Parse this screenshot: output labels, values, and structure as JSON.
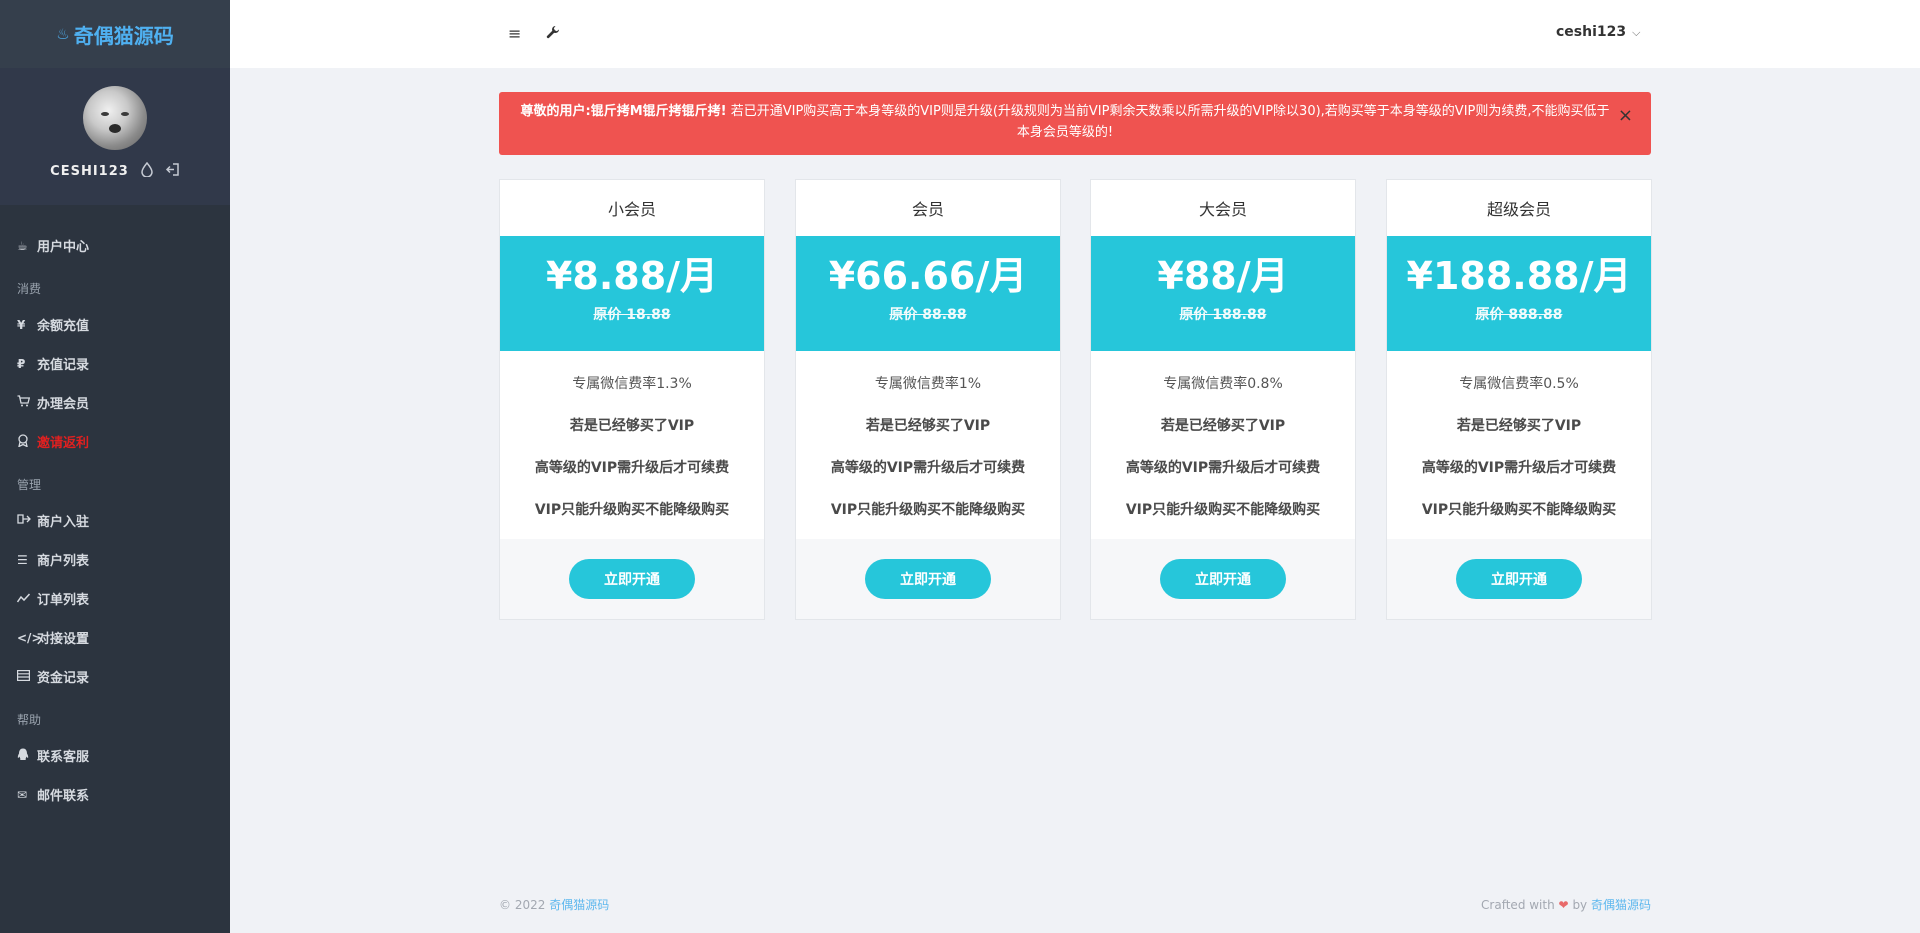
{
  "brand": {
    "icon": "flame-icon",
    "name": "奇偶猫源码"
  },
  "profile": {
    "username": "CESHI123",
    "icons": [
      "droplet-icon",
      "logout-icon"
    ]
  },
  "nav": {
    "top": [
      {
        "label": "用户中心",
        "icon": "cup-icon"
      }
    ],
    "groups": [
      {
        "heading": "消费",
        "items": [
          {
            "label": "余额充值",
            "icon": "yen-icon"
          },
          {
            "label": "充值记录",
            "icon": "ruble-icon"
          },
          {
            "label": "办理会员",
            "icon": "cart-icon"
          },
          {
            "label": "邀请返利",
            "icon": "award-icon",
            "color": "#e02020"
          }
        ]
      },
      {
        "heading": "管理",
        "items": [
          {
            "label": "商户入驻",
            "icon": "sign-in-icon"
          },
          {
            "label": "商户列表",
            "icon": "list-icon"
          },
          {
            "label": "订单列表",
            "icon": "chart-line-icon"
          },
          {
            "label": "对接设置",
            "icon": "code-icon"
          },
          {
            "label": "资金记录",
            "icon": "table-icon"
          }
        ]
      },
      {
        "heading": "帮助",
        "items": [
          {
            "label": "联系客服",
            "icon": "qq-icon"
          },
          {
            "label": "邮件联系",
            "icon": "envelope-icon"
          }
        ]
      }
    ]
  },
  "topbar": {
    "menu_icon": "hamburger-icon",
    "tool_icon": "wrench-icon",
    "user": "ceshi123"
  },
  "alert": {
    "strong": "尊敬的用户:锟斤拷M锟斤拷锟斤拷!",
    "text": " 若已开通VIP购买高于本身等级的VIP则是升级(升级规则为当前VIP剩余天数乘以所需升级的VIP除以30),若购买等于本身等级的VIP则为续费,不能购买低于本身会员等级的!",
    "close": "×",
    "color": "#ef5350"
  },
  "plans": [
    {
      "name": "小会员",
      "price": "¥8.88/月",
      "original": "原价 18.88",
      "features": [
        "专属微信费率1.3%",
        "若是已经够买了VIP",
        "高等级的VIP需升级后才可续费",
        "VIP只能升级购买不能降级购买"
      ],
      "button": "立即开通"
    },
    {
      "name": "会员",
      "price": "¥66.66/月",
      "original": "原价 88.88",
      "features": [
        "专属微信费率1%",
        "若是已经够买了VIP",
        "高等级的VIP需升级后才可续费",
        "VIP只能升级购买不能降级购买"
      ],
      "button": "立即开通"
    },
    {
      "name": "大会员",
      "price": "¥88/月",
      "original": "原价 188.88",
      "features": [
        "专属微信费率0.8%",
        "若是已经够买了VIP",
        "高等级的VIP需升级后才可续费",
        "VIP只能升级购买不能降级购买"
      ],
      "button": "立即开通"
    },
    {
      "name": "超级会员",
      "price": "¥188.88/月",
      "original": "原价 888.88",
      "features": [
        "专属微信费率0.5%",
        "若是已经够买了VIP",
        "高等级的VIP需升级后才可续费",
        "VIP只能升级购买不能降级购买"
      ],
      "button": "立即开通"
    }
  ],
  "accent_color": "#26c6da",
  "footer": {
    "copyright": "© 2022",
    "site": "奇偶猫源码",
    "crafted": "Crafted with",
    "heart": "❤",
    "by": "by",
    "author": "奇偶猫源码"
  }
}
